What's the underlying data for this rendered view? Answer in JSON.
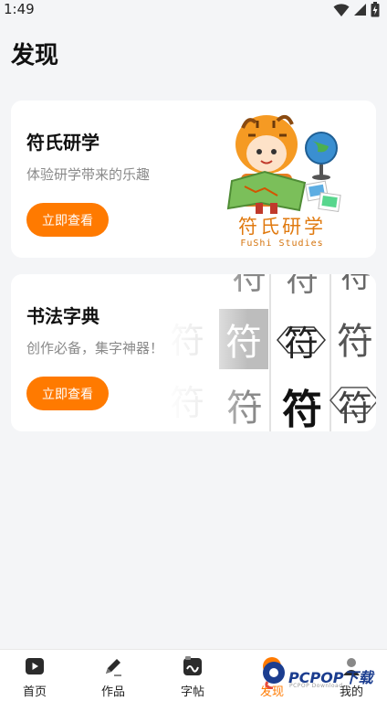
{
  "status_bar": {
    "time": "1:49",
    "icons": [
      "wifi-icon",
      "cellular-icon",
      "battery-charging-icon"
    ]
  },
  "page": {
    "title": "发现"
  },
  "cards": [
    {
      "title": "符氏研学",
      "subtitle": "体验研学带来的乐趣",
      "button": "立即查看",
      "brand_cn": "符氏研学",
      "brand_en": "FuShi Studies"
    },
    {
      "title": "书法字典",
      "subtitle": "创作必备，集字神器！",
      "button": "立即查看",
      "glyph": "符"
    }
  ],
  "bottom_nav": {
    "items": [
      {
        "label": "首页",
        "icon": "play-video-icon",
        "active": false
      },
      {
        "label": "作品",
        "icon": "pen-icon",
        "active": false
      },
      {
        "label": "字帖",
        "icon": "copybook-icon",
        "active": false
      },
      {
        "label": "发现",
        "icon": "discover-icon",
        "active": true
      },
      {
        "label": "我的",
        "icon": "profile-icon",
        "active": false
      }
    ]
  },
  "watermark": {
    "text": "PCPOP下载",
    "sub": "PCPOP Download"
  },
  "colors": {
    "accent": "#ff7a00",
    "background": "#f4f5f7",
    "card": "#ffffff"
  }
}
